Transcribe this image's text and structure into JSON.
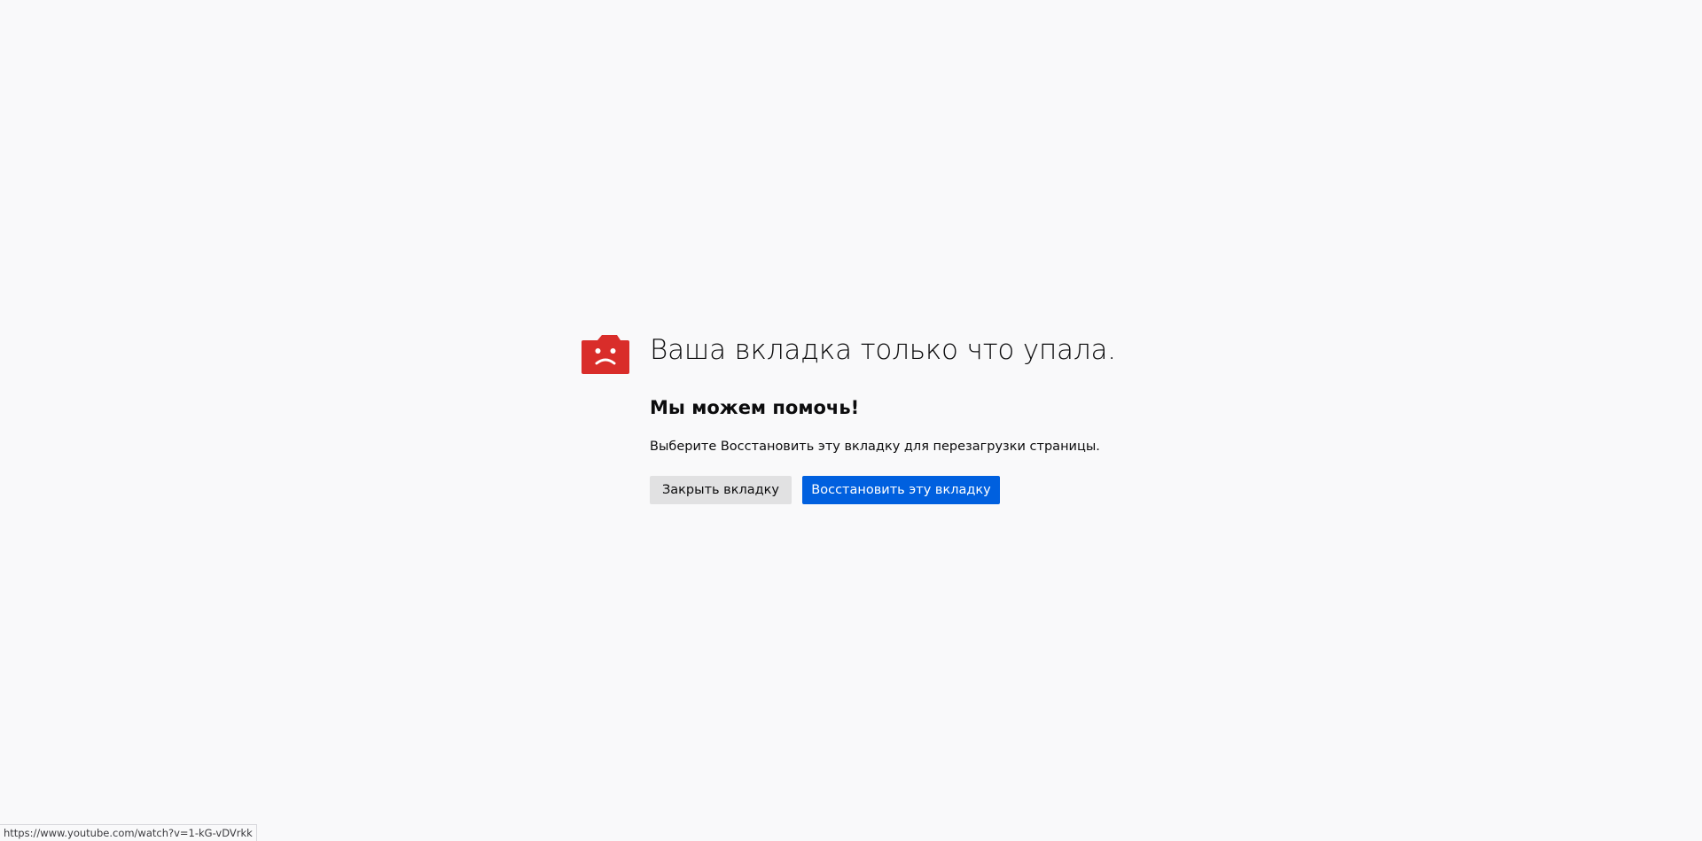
{
  "crash": {
    "title": "Ваша вкладка только что упала.",
    "subtitle": "Мы можем помочь!",
    "description": "Выберите Восстановить эту вкладку для перезагрузки страницы.",
    "icon": "sad-tab-icon",
    "icon_color": "#d92d2a"
  },
  "buttons": {
    "close_label": "Закрыть вкладку",
    "restore_label": "Восстановить эту вкладку",
    "primary_color": "#0060df"
  },
  "status_bar": {
    "url": "https://www.youtube.com/watch?v=1-kG-vDVrkk"
  }
}
